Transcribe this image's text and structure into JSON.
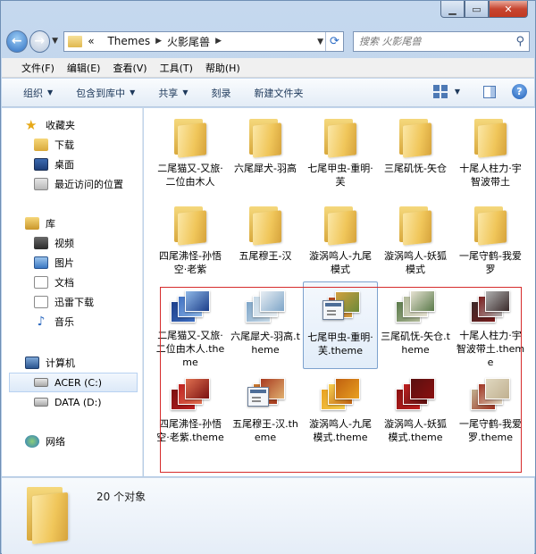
{
  "breadcrumb": {
    "overflow": "«",
    "items": [
      "Themes",
      "火影尾兽"
    ]
  },
  "search": {
    "placeholder": "搜索 火影尾兽"
  },
  "menu": [
    "文件(F)",
    "编辑(E)",
    "查看(V)",
    "工具(T)",
    "帮助(H)"
  ],
  "commands": {
    "organize": "组织",
    "include": "包含到库中",
    "share": "共享",
    "burn": "刻录",
    "new_folder": "新建文件夹"
  },
  "nav": {
    "favorites": {
      "label": "收藏夹",
      "items": [
        "下载",
        "桌面",
        "最近访问的位置"
      ]
    },
    "libraries": {
      "label": "库",
      "items": [
        "视频",
        "图片",
        "文档",
        "迅雷下载",
        "音乐"
      ]
    },
    "computer": {
      "label": "计算机",
      "items": [
        "ACER (C:)",
        "DATA (D:)"
      ]
    },
    "network": {
      "label": "网络"
    }
  },
  "folders": [
    "二尾猫又-又旅·二位由木人",
    "六尾犀犬-羽高",
    "七尾甲虫-重明·芙",
    "三尾矶怃-矢仓",
    "十尾人柱力·宇智波带土",
    "四尾沸怪-孙悟空·老紫",
    "五尾穆王-汉",
    "漩涡鸣人-九尾模式",
    "漩涡鸣人-妖狐模式",
    "一尾守鹤-我爱罗"
  ],
  "themes": [
    {
      "label": "二尾猫又-又旅·二位由木人.theme",
      "colors": [
        "#1d3f8a",
        "#3e6fc2",
        "#8fb8e8"
      ]
    },
    {
      "label": "六尾犀犬-羽高.theme",
      "colors": [
        "#7ea5c8",
        "#c5d8e6",
        "#e8eef3"
      ]
    },
    {
      "label": "七尾甲虫-重明·芙.theme",
      "colors": [
        "#b04020",
        "#d2a040",
        "#6a8a3a"
      ],
      "generic": true,
      "selected": true
    },
    {
      "label": "三尾矶怃-矢仓.theme",
      "colors": [
        "#5a7a4a",
        "#b0b898",
        "#e6e2d2"
      ]
    },
    {
      "label": "十尾人柱力·宇智波带土.theme",
      "colors": [
        "#3a2a2a",
        "#7a1a1a",
        "#b0b0b0"
      ]
    },
    {
      "label": "四尾沸怪-孙悟空·老紫.theme",
      "colors": [
        "#7a1010",
        "#c02020",
        "#e07050"
      ]
    },
    {
      "label": "五尾穆王-汉.theme",
      "colors": [
        "#c87a30",
        "#a83a20",
        "#e0b070"
      ],
      "generic": true
    },
    {
      "label": "漩涡鸣人-九尾模式.theme",
      "colors": [
        "#e8a020",
        "#f6d050",
        "#c06010"
      ]
    },
    {
      "label": "漩涡鸣人-妖狐模式.theme",
      "colors": [
        "#8a1010",
        "#c02020",
        "#5a1010"
      ]
    },
    {
      "label": "一尾守鹤-我爱罗.theme",
      "colors": [
        "#c0b090",
        "#a03020",
        "#e0d8c0"
      ]
    }
  ],
  "status": {
    "count": "20 个对象"
  }
}
